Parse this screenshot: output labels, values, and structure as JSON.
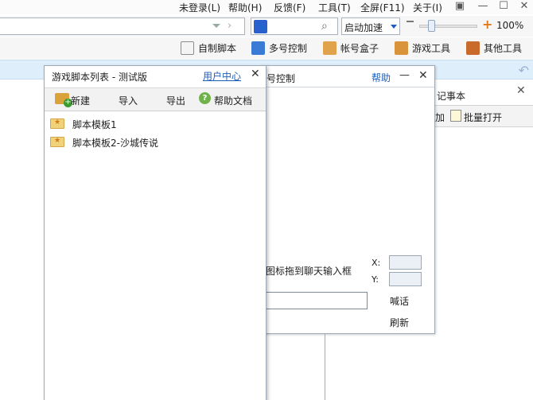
{
  "menu": {
    "login": "未登录(L)",
    "help": "帮助(H)",
    "feedback": "反馈(F)",
    "tools": "工具(T)",
    "fullscreen": "全屏(F11)",
    "about": "关于(I)"
  },
  "addressbar": {
    "search_engine_icon": "baidu-paw-icon",
    "accelerate_label": "启动加速",
    "zoom_value": "100%",
    "zoom_level_fraction": 0.15
  },
  "toolbar": {
    "items": [
      {
        "label": "自制脚本",
        "icon": "script-edit-icon"
      },
      {
        "label": "多号控制",
        "icon": "multi-account-icon"
      },
      {
        "label": "帐号盒子",
        "icon": "account-box-icon"
      },
      {
        "label": "游戏工具",
        "icon": "game-tools-icon"
      },
      {
        "label": "其他工具",
        "icon": "other-tools-icon"
      }
    ]
  },
  "notepad": {
    "title": "记事本",
    "add_label": "加",
    "batch_open_label": "批量打开"
  },
  "multi_control": {
    "title": "号控制",
    "help": "帮助",
    "drag_hint": "图标拖到聊天输入框",
    "x_label": "X:",
    "y_label": "Y:",
    "shout_label": "喊话",
    "refresh_label": "刷新"
  },
  "script_list": {
    "title": "游戏脚本列表 - 测试版",
    "user_center": "用户中心",
    "buttons": {
      "new": "新建",
      "import": "导入",
      "export": "导出",
      "help_doc": "帮助文档"
    },
    "items": [
      {
        "label": "脚本模板1"
      },
      {
        "label": "脚本模板2-沙城传说"
      }
    ]
  }
}
